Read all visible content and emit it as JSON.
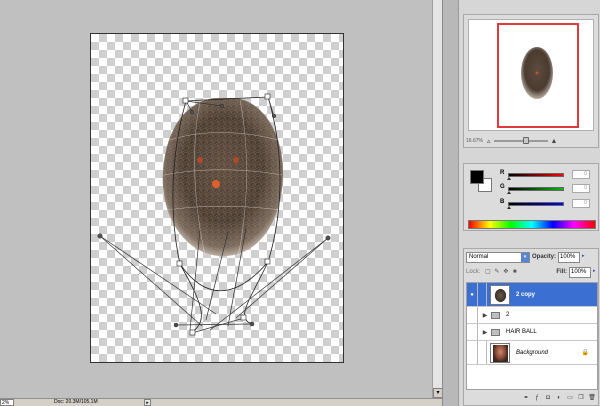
{
  "status": {
    "zoom": "2%",
    "doc_info": "Doc: 20.3M/105.1M",
    "menu_arrow": "▸"
  },
  "navigator": {
    "zoom_pct": "16.67%",
    "zoom_out": "▵",
    "zoom_in": "▲",
    "slider_level": 0.62
  },
  "color": {
    "foreground": "#000000",
    "background": "#ffffff",
    "channels": [
      {
        "label": "R",
        "value": "0",
        "gradient": "linear-gradient(to right,#000,#ff0000)"
      },
      {
        "label": "G",
        "value": "0",
        "gradient": "linear-gradient(to right,#000,#00c000)"
      },
      {
        "label": "B",
        "value": "0",
        "gradient": "linear-gradient(to right,#000,#0000ff)"
      }
    ]
  },
  "layers": {
    "blend_mode": "Normal",
    "opacity_label": "Opacity:",
    "opacity_value": "100%",
    "fill_label": "Fill:",
    "fill_value": "100%",
    "lock_label": "Lock:",
    "items": [
      {
        "name": "2 copy",
        "type": "layer",
        "selected": true,
        "visible": true
      },
      {
        "name": "2",
        "type": "group",
        "selected": false,
        "visible": false
      },
      {
        "name": "HAIR BALL",
        "type": "group",
        "selected": false,
        "visible": false
      },
      {
        "name": "Background",
        "type": "background",
        "selected": false,
        "visible": false,
        "locked": true
      }
    ]
  },
  "colors": {
    "accent": "#3b6fd1",
    "navigator_view": "#e03a3a"
  }
}
